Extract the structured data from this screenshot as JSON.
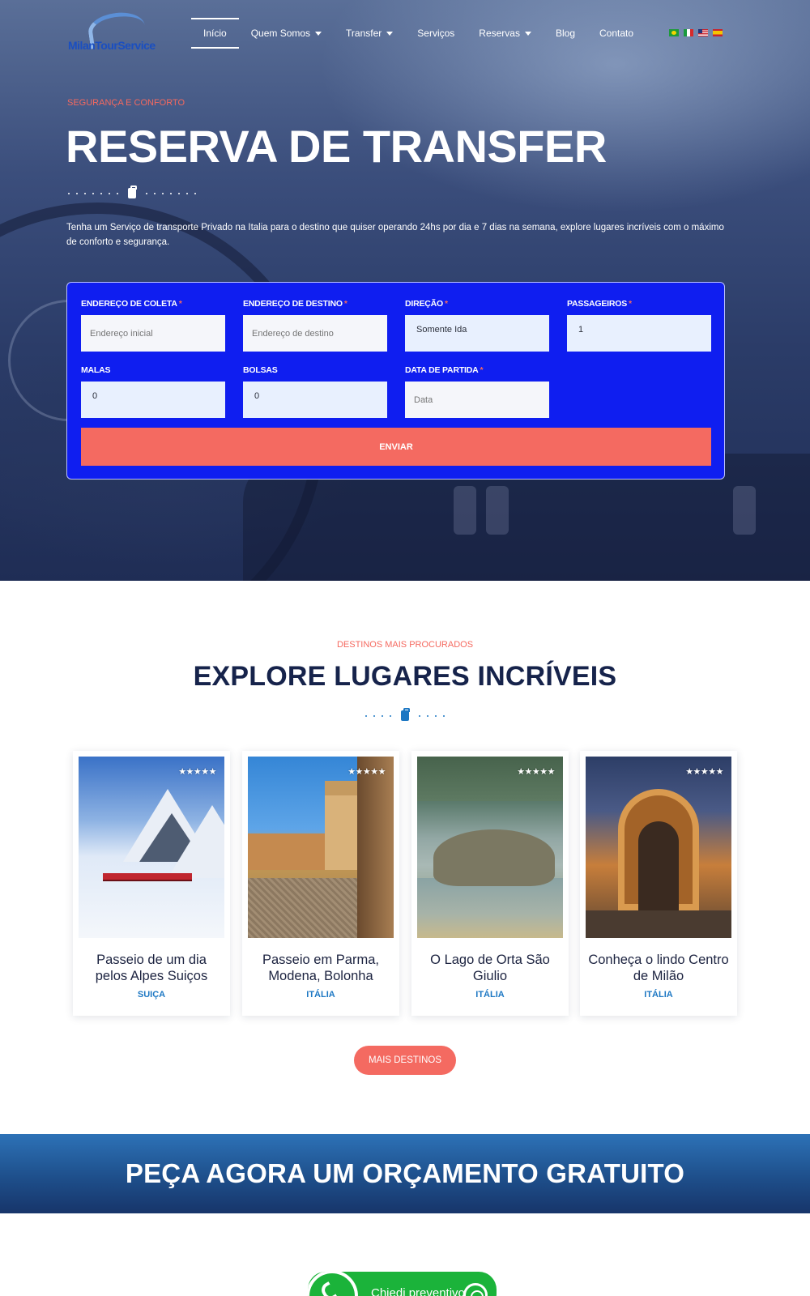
{
  "header": {
    "logo_text": "MilanTourService",
    "nav": [
      {
        "label": "Início",
        "active": true,
        "dropdown": false
      },
      {
        "label": "Quem Somos",
        "active": false,
        "dropdown": true
      },
      {
        "label": "Transfer",
        "active": false,
        "dropdown": true
      },
      {
        "label": "Serviços",
        "active": false,
        "dropdown": false
      },
      {
        "label": "Reservas",
        "active": false,
        "dropdown": true
      },
      {
        "label": "Blog",
        "active": false,
        "dropdown": false
      },
      {
        "label": "Contato",
        "active": false,
        "dropdown": false
      }
    ],
    "languages": [
      "br-flag-icon",
      "it-flag-icon",
      "us-flag-icon",
      "es-flag-icon"
    ]
  },
  "hero": {
    "kicker": "SEGURANÇA E CONFORTO",
    "title": "RESERVA DE TRANSFER",
    "text": "Tenha um Serviço de transporte Privado na Italia para o destino que quiser operando 24hs por dia e 7 dias na semana, explore lugares incríveis com o máximo de conforto e segurança."
  },
  "form": {
    "pickup": {
      "label": "ENDEREÇO DE COLETA",
      "required": "*",
      "placeholder": "Endereço inicial",
      "value": ""
    },
    "destination": {
      "label": "ENDEREÇO DE DESTINO",
      "required": "*",
      "placeholder": "Endereço de destino",
      "value": ""
    },
    "direction": {
      "label": "DIREÇÃO",
      "required": "*",
      "value": "Somente Ida"
    },
    "passengers": {
      "label": "PASSAGEIROS",
      "required": "*",
      "value": "1"
    },
    "bags": {
      "label": "MALAS",
      "value": "0"
    },
    "handbags": {
      "label": "BOLSAS",
      "value": "0"
    },
    "date": {
      "label": "DATA DE PARTIDA",
      "required": "*",
      "placeholder": "Data",
      "value": ""
    },
    "submit_label": "ENVIAR"
  },
  "explore": {
    "kicker": "DESTINOS MAIS PROCURADOS",
    "title": "EXPLORE LUGARES INCRÍVEIS",
    "cards": [
      {
        "title": "Passeio de um dia pelos Alpes Suiços",
        "country": "SUIÇA",
        "stars": "★★★★★",
        "rating": 5
      },
      {
        "title": "Passeio em Parma, Modena, Bolonha",
        "country": "ITÁLIA",
        "stars": "★★★★★",
        "rating": 5
      },
      {
        "title": "O Lago de Orta São Giulio",
        "country": "ITÁLIA",
        "stars": "★★★★★",
        "rating": 5
      },
      {
        "title": "Conheça o lindo Centro de Milão",
        "country": "ITÁLIA",
        "stars": "★★★★★",
        "rating": 5
      }
    ],
    "more_label": "MAIS DESTINOS"
  },
  "cta": {
    "title": "PEÇA AGORA UM ORÇAMENTO GRATUITO"
  },
  "whatsapp": {
    "label": "Chiedi preventivo"
  },
  "colors": {
    "accent": "#f46a61",
    "form_bg": "#0f1ef0",
    "navy": "#16234b",
    "link_blue": "#1c77c3",
    "whatsapp_green": "#1bb33a"
  }
}
